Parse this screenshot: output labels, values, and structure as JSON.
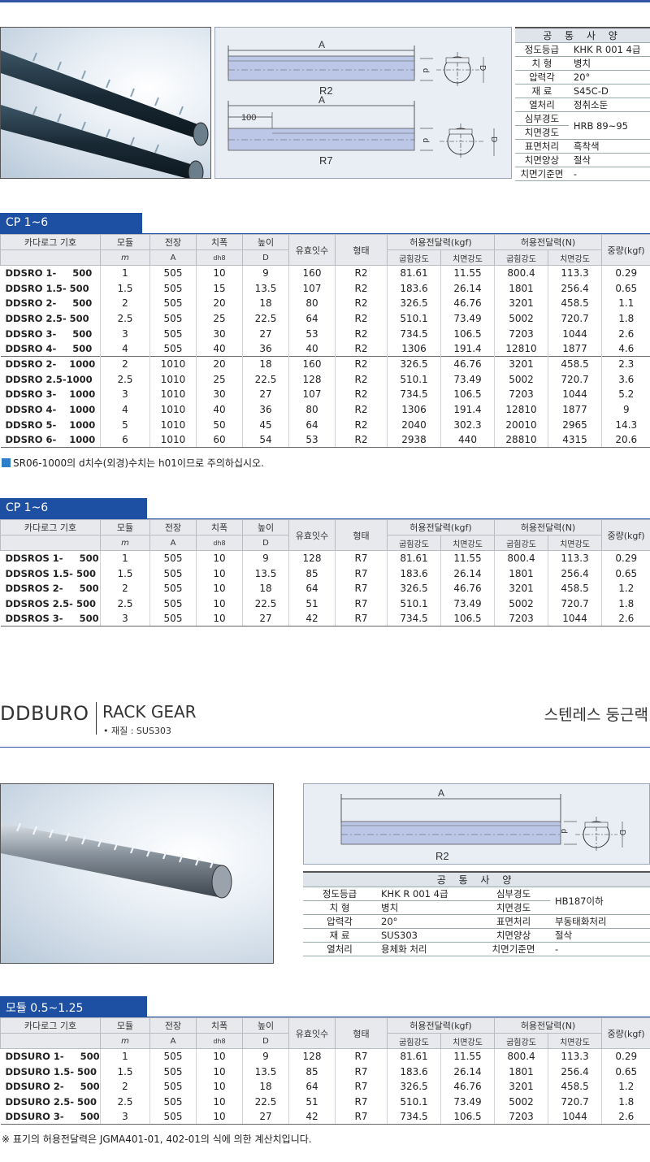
{
  "section1": {
    "diagram": {
      "r2_label": "R2",
      "r7_label": "R7",
      "dim_a": "A",
      "dim_100": "100",
      "dim_d": "d",
      "dim_D": "D"
    },
    "spec": {
      "title": "공 통 사 양",
      "rows": [
        {
          "k": "정도등급",
          "v": "KHK R 001 4급"
        },
        {
          "k": "치 형",
          "v": "병치"
        },
        {
          "k": "압력각",
          "v": "20°"
        },
        {
          "k": "재 료",
          "v": "S45C-D"
        },
        {
          "k": "열처리",
          "v": "정취소둔"
        },
        {
          "k": "심부경도",
          "v": "HRB 89~95"
        },
        {
          "k": "치면경도",
          "v": ""
        },
        {
          "k": "표면처리",
          "v": "흑착색"
        },
        {
          "k": "치면양상",
          "v": "절삭"
        },
        {
          "k": "치면기준면",
          "v": "-"
        }
      ]
    }
  },
  "headers": {
    "catalog": "카다로그 기호",
    "module": "모듈",
    "module_unit": "m",
    "length": "전장",
    "length_unit": "A",
    "width": "치폭",
    "width_unit": "dh8",
    "height": "높이",
    "height_unit": "D",
    "teeth": "유효잇수",
    "shape": "형태",
    "force_kgf": "허용전달력(kgf)",
    "force_n": "허용전달력(N)",
    "bend": "굽힘강도",
    "surface": "치면강도",
    "weight": "중량(kgf)"
  },
  "table1": {
    "tab": "CP 1~6",
    "group1": [
      [
        "DDSRO 1-     500",
        "1",
        "505",
        "10",
        "9",
        "160",
        "R2",
        "81.61",
        "11.55",
        "800.4",
        "113.3",
        "0.29"
      ],
      [
        "DDSRO 1.5- 500",
        "1.5",
        "505",
        "15",
        "13.5",
        "107",
        "R2",
        "183.6",
        "26.14",
        "1801",
        "256.4",
        "0.65"
      ],
      [
        "DDSRO 2-     500",
        "2",
        "505",
        "20",
        "18",
        "80",
        "R2",
        "326.5",
        "46.76",
        "3201",
        "458.5",
        "1.1"
      ],
      [
        "DDSRO 2.5- 500",
        "2.5",
        "505",
        "25",
        "22.5",
        "64",
        "R2",
        "510.1",
        "73.49",
        "5002",
        "720.7",
        "1.8"
      ],
      [
        "DDSRO 3-     500",
        "3",
        "505",
        "30",
        "27",
        "53",
        "R2",
        "734.5",
        "106.5",
        "7203",
        "1044",
        "2.6"
      ],
      [
        "DDSRO 4-     500",
        "4",
        "505",
        "40",
        "36",
        "40",
        "R2",
        "1306",
        "191.4",
        "12810",
        "1877",
        "4.6"
      ]
    ],
    "group2": [
      [
        "DDSRO 2-    1000",
        "2",
        "1010",
        "20",
        "18",
        "160",
        "R2",
        "326.5",
        "46.76",
        "3201",
        "458.5",
        "2.3"
      ],
      [
        "DDSRO 2.5-1000",
        "2.5",
        "1010",
        "25",
        "22.5",
        "128",
        "R2",
        "510.1",
        "73.49",
        "5002",
        "720.7",
        "3.6"
      ],
      [
        "DDSRO 3-    1000",
        "3",
        "1010",
        "30",
        "27",
        "107",
        "R2",
        "734.5",
        "106.5",
        "7203",
        "1044",
        "5.2"
      ],
      [
        "DDSRO 4-    1000",
        "4",
        "1010",
        "40",
        "36",
        "80",
        "R2",
        "1306",
        "191.4",
        "12810",
        "1877",
        "9"
      ],
      [
        "DDSRO 5-    1000",
        "5",
        "1010",
        "50",
        "45",
        "64",
        "R2",
        "2040",
        "302.3",
        "20010",
        "2965",
        "14.3"
      ],
      [
        "DDSRO 6-    1000",
        "6",
        "1010",
        "60",
        "54",
        "53",
        "R2",
        "2938",
        "440",
        "28810",
        "4315",
        "20.6"
      ]
    ],
    "note": "SR06-1000의 d치수(외경)수치는  h01이므로 주의하십시오."
  },
  "table2": {
    "tab": "CP 1~6",
    "rows": [
      [
        "DDSROS 1-     500",
        "1",
        "505",
        "10",
        "9",
        "128",
        "R7",
        "81.61",
        "11.55",
        "800.4",
        "113.3",
        "0.29"
      ],
      [
        "DDSROS 1.5- 500",
        "1.5",
        "505",
        "10",
        "13.5",
        "85",
        "R7",
        "183.6",
        "26.14",
        "1801",
        "256.4",
        "0.65"
      ],
      [
        "DDSROS 2-     500",
        "2",
        "505",
        "10",
        "18",
        "64",
        "R7",
        "326.5",
        "46.76",
        "3201",
        "458.5",
        "1.2"
      ],
      [
        "DDSROS 2.5- 500",
        "2.5",
        "505",
        "10",
        "22.5",
        "51",
        "R7",
        "510.1",
        "73.49",
        "5002",
        "720.7",
        "1.8"
      ],
      [
        "DDSROS 3-     500",
        "3",
        "505",
        "10",
        "27",
        "42",
        "R7",
        "734.5",
        "106.5",
        "7203",
        "1044",
        "2.6"
      ]
    ]
  },
  "section2": {
    "brand": "DDBURO",
    "subtitle": "RACK GEAR",
    "material": "• 재질 : SUS303",
    "korean_name": "스텐레스 둥근랙",
    "diagram": {
      "label": "R2",
      "dim_a": "A",
      "dim_d": "d",
      "dim_D": "D"
    },
    "spec": {
      "title": "공 통 사 양",
      "rows": [
        {
          "k1": "정도등급",
          "v1": "KHK R 001 4급",
          "k2": "심부경도",
          "v2": "HB187이하"
        },
        {
          "k1": "치 형",
          "v1": "병치",
          "k2": "치면경도",
          "v2": ""
        },
        {
          "k1": "압력각",
          "v1": "20°",
          "k2": "표면처리",
          "v2": "부동태화처리"
        },
        {
          "k1": "재 료",
          "v1": "SUS303",
          "k2": "치면양상",
          "v2": "절삭"
        },
        {
          "k1": "열처리",
          "v1": "용체화 처리",
          "k2": "치면기준면",
          "v2": "-"
        }
      ]
    }
  },
  "table3": {
    "tab": "모듈 0.5~1.25",
    "rows": [
      [
        "DDSURO 1-     500",
        "1",
        "505",
        "10",
        "9",
        "128",
        "R7",
        "81.61",
        "11.55",
        "800.4",
        "113.3",
        "0.29"
      ],
      [
        "DDSURO 1.5- 500",
        "1.5",
        "505",
        "10",
        "13.5",
        "85",
        "R7",
        "183.6",
        "26.14",
        "1801",
        "256.4",
        "0.65"
      ],
      [
        "DDSURO 2-     500",
        "2",
        "505",
        "10",
        "18",
        "64",
        "R7",
        "326.5",
        "46.76",
        "3201",
        "458.5",
        "1.2"
      ],
      [
        "DDSURO 2.5- 500",
        "2.5",
        "505",
        "10",
        "22.5",
        "51",
        "R7",
        "510.1",
        "73.49",
        "5002",
        "720.7",
        "1.8"
      ],
      [
        "DDSURO 3-     500",
        "3",
        "505",
        "10",
        "27",
        "42",
        "R7",
        "734.5",
        "106.5",
        "7203",
        "1044",
        "2.6"
      ]
    ],
    "note": "※ 표기의 허용전달력은 JGMA401-01, 402-01의  식에 의한 계산치입니다."
  }
}
